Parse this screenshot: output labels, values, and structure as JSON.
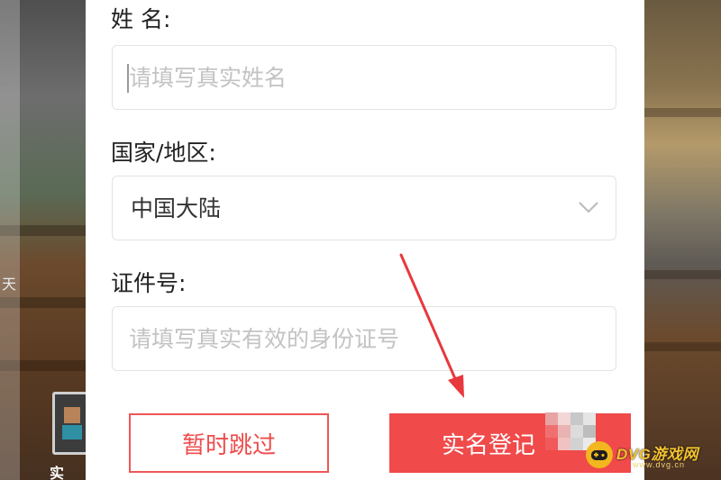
{
  "form": {
    "name_label": "姓 名:",
    "name_placeholder": "请填写真实姓名",
    "region_label": "国家/地区:",
    "region_value": "中国大陆",
    "id_label": "证件号:",
    "id_placeholder": "请填写真实有效的身份证号"
  },
  "buttons": {
    "skip_label": "暂时跳过",
    "confirm_label": "实名登记"
  },
  "background": {
    "left_edge_text": "天",
    "figure_caption": "实"
  },
  "watermark": {
    "title": "DVG游戏网",
    "url": "www.dvg.cn"
  },
  "colors": {
    "accent": "#f04a4a",
    "placeholder": "#c3c3c3",
    "border": "#e3e3e3"
  },
  "icons": {
    "region_dropdown": "chevron-down-icon",
    "annotation": "red-arrow-icon"
  }
}
